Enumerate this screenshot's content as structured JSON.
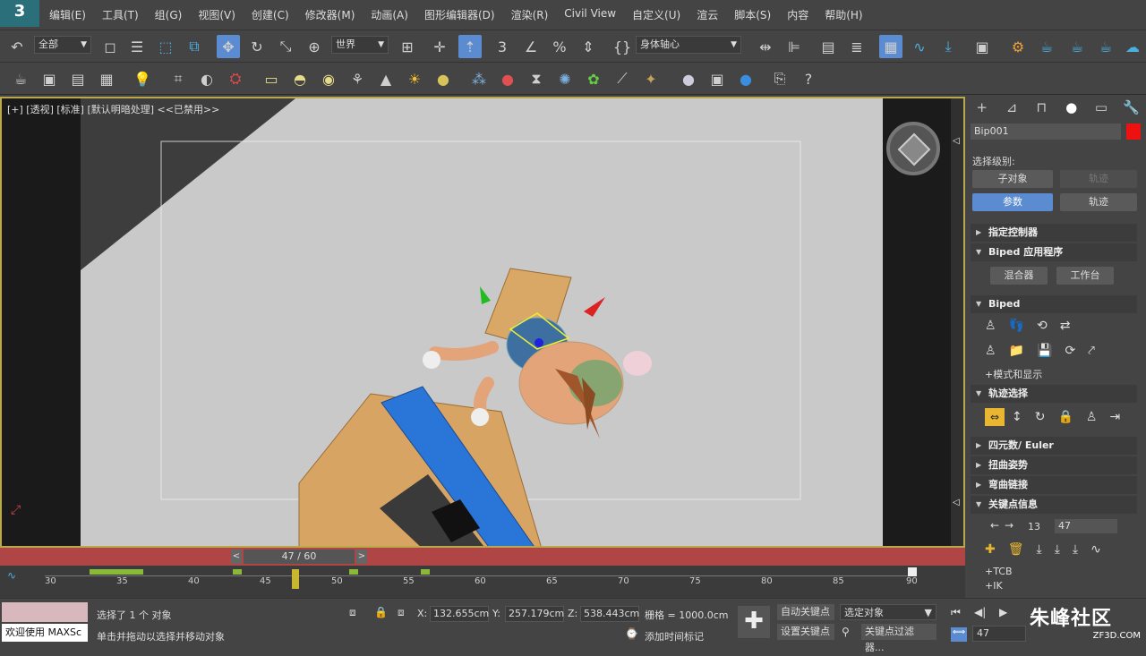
{
  "menu": {
    "logo": "3",
    "items": [
      "编辑(E)",
      "工具(T)",
      "组(G)",
      "视图(V)",
      "创建(C)",
      "修改器(M)",
      "动画(A)",
      "图形编辑器(D)",
      "渲染(R)",
      "Civil View",
      "自定义(U)",
      "渲云",
      "脚本(S)",
      "内容",
      "帮助(H)"
    ]
  },
  "toolbar": {
    "selection_filter": "全部",
    "ref_coord": "世界",
    "pivot": "身体轴心"
  },
  "viewport": {
    "label": "[+] [透视] [标准] [默认明暗处理] <<已禁用>>"
  },
  "command_panel": {
    "object_name": "Bip001",
    "object_color": "#ee1111",
    "selection_level_label": "选择级别:",
    "sub_object": "子对象",
    "track": "轨迹",
    "params": "参数",
    "track2": "轨迹",
    "rollouts": {
      "assign_controller": "指定控制器",
      "biped_apps": "Biped 应用程序",
      "mixer": "混合器",
      "workbench": "工作台",
      "biped": "Biped",
      "mode_display": "+模式和显示",
      "track_select": "轨迹选择",
      "quat_euler": "四元数/ Euler",
      "twist_pose": "扭曲姿势",
      "bend_links": "弯曲链接",
      "key_info": "关键点信息",
      "key_num": "13",
      "key_frame": "47",
      "tcb": "+TCB",
      "ik": "+IK"
    }
  },
  "timeline": {
    "slider": "47 / 60",
    "ticks": [
      "30",
      "35",
      "40",
      "45",
      "50",
      "55",
      "60",
      "65",
      "70",
      "75",
      "80",
      "85",
      "90"
    ]
  },
  "status": {
    "selected": "选择了 1 个 对象",
    "hint": "单击并拖动以选择并移动对象",
    "welcome": "欢迎使用 MAXSc",
    "x_label": "X:",
    "x": "132.655cm",
    "y_label": "Y:",
    "y": "257.179cm",
    "z_label": "Z:",
    "z": "538.443cm",
    "grid": "栅格 = 1000.0cm",
    "add_time_tag": "添加时间标记",
    "auto_key": "自动关键点",
    "set_key": "设置关键点",
    "selected_obj": "选定对象",
    "key_filters": "关键点过滤器...",
    "frame": "47"
  },
  "watermark": {
    "brand": "朱峰社区",
    "url": "ZF3D.COM"
  }
}
